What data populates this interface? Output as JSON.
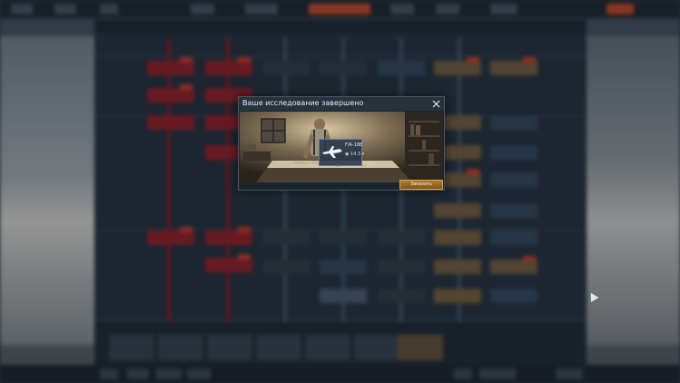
{
  "dialog": {
    "title": "Ваше исследование завершено",
    "close_icon": "close-icon",
    "order_button_label": "Заказать"
  },
  "unit": {
    "name": "F/A-18E",
    "battle_rating": "14.3",
    "icon": "jet-aircraft-icon"
  },
  "colors": {
    "accent_gold": "#b07d2e",
    "dialog_bg": "#1c242d",
    "header_bg": "#28323d",
    "researched_red": "#8c1f28"
  }
}
